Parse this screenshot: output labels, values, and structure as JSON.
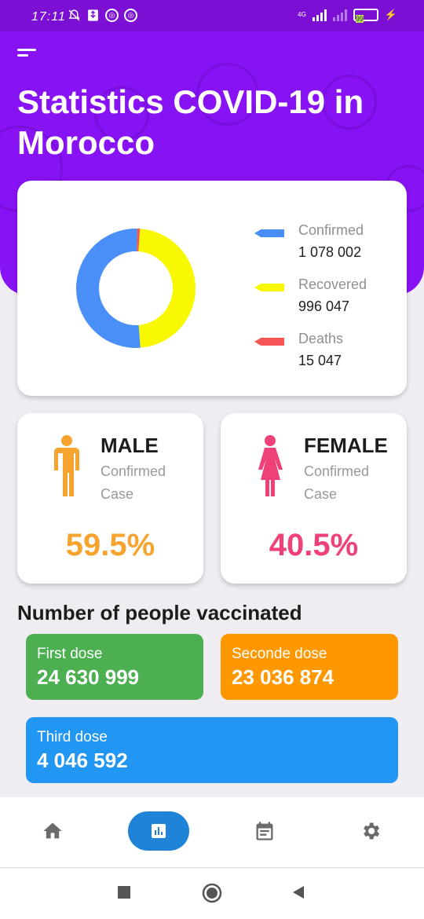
{
  "status_bar": {
    "time": "17:11",
    "network": "4G",
    "battery": "99"
  },
  "header": {
    "title": "Statistics COVID-19 in Morocco"
  },
  "stats": {
    "legend": [
      {
        "label": "Confirmed",
        "value": "1 078 002",
        "color": "#4a8ff7"
      },
      {
        "label": "Recovered",
        "value": "996 047",
        "color": "#f8f800"
      },
      {
        "label": "Deaths",
        "value": "15 047",
        "color": "#f55555"
      }
    ],
    "chart_data": {
      "type": "donut",
      "series": [
        {
          "name": "Confirmed",
          "value": 1078002,
          "color": "#4a8ff7"
        },
        {
          "name": "Recovered",
          "value": 996047,
          "color": "#f8f800"
        },
        {
          "name": "Deaths",
          "value": 15047,
          "color": "#f55555"
        }
      ]
    }
  },
  "gender": {
    "male": {
      "title": "MALE",
      "subtitle": "Confirmed Case",
      "percent": "59.5%",
      "color": "#f6a32f",
      "icon": "male-person-icon"
    },
    "female": {
      "title": "FEMALE",
      "subtitle": "Confirmed Case",
      "percent": "40.5%",
      "color": "#ee4178",
      "icon": "female-person-icon"
    }
  },
  "vaccination": {
    "title": "Number of people vaccinated",
    "doses": [
      {
        "label": "First dose",
        "value": "24 630 999",
        "color": "#4caf50"
      },
      {
        "label": "Seconde dose",
        "value": "23 036 874",
        "color": "#ff9800"
      },
      {
        "label": "Third dose",
        "value": "4 046 592",
        "color": "#2196f3"
      }
    ]
  },
  "nav": {
    "items": [
      {
        "name": "home",
        "icon": "home-icon",
        "active": false
      },
      {
        "name": "statistics",
        "icon": "bar-chart-icon",
        "active": true
      },
      {
        "name": "calendar",
        "icon": "calendar-icon",
        "active": false
      },
      {
        "name": "settings",
        "icon": "gear-icon",
        "active": false
      }
    ]
  }
}
